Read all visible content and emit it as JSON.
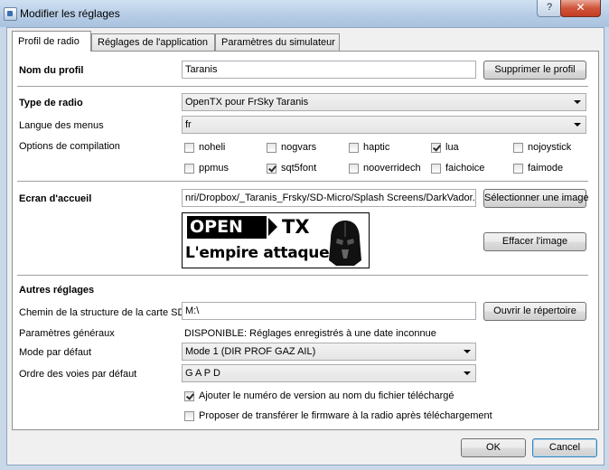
{
  "window": {
    "title": "Modifier les réglages",
    "help_label": "?",
    "close_label": "✕"
  },
  "tabs": [
    {
      "label": "Profil de radio",
      "active": true
    },
    {
      "label": "Réglages de l'application",
      "active": false
    },
    {
      "label": "Paramètres du simulateur",
      "active": false
    }
  ],
  "profile": {
    "name_label": "Nom du profil",
    "name_value": "Taranis",
    "delete_button": "Supprimer le profil"
  },
  "radio": {
    "type_label": "Type de radio",
    "type_value": "OpenTX pour FrSky Taranis",
    "language_label": "Langue des menus",
    "language_value": "fr",
    "compile_label": "Options de compilation",
    "options": [
      {
        "label": "noheli",
        "checked": false
      },
      {
        "label": "nogvars",
        "checked": false
      },
      {
        "label": "haptic",
        "checked": false
      },
      {
        "label": "lua",
        "checked": true
      },
      {
        "label": "nojoystick",
        "checked": false
      },
      {
        "label": "ppmus",
        "checked": false
      },
      {
        "label": "sqt5font",
        "checked": true
      },
      {
        "label": "nooverridech",
        "checked": false
      },
      {
        "label": "faichoice",
        "checked": false
      },
      {
        "label": "faimode",
        "checked": false
      }
    ]
  },
  "splash": {
    "label": "Ecran d'accueil",
    "path_value": "nri/Dropbox/_Taranis_Frsky/SD-Micro/Splash Screens/DarkVador.bmp",
    "select_button": "Sélectionner une image",
    "clear_button": "Effacer l'image",
    "image_line1_a": "OPEN",
    "image_line1_b": "TX",
    "image_line2": "L'empire attaque"
  },
  "other": {
    "heading": "Autres réglages",
    "sd_label": "Chemin de la structure de la carte SD",
    "sd_value": "M:\\",
    "open_dir_button": "Ouvrir le répertoire",
    "general_label": "Paramètres généraux",
    "general_value": "DISPONIBLE: Réglages enregistrés à une date inconnue",
    "mode_label": "Mode par défaut",
    "mode_value": "Mode 1 (DIR PROF GAZ AIL)",
    "order_label": "Ordre des voies par défaut",
    "order_value": "G A P D",
    "append_version_label": "Ajouter le numéro de version au nom du fichier téléchargé",
    "append_version_checked": true,
    "offer_transfer_label": "Proposer de transférer le firmware à la radio après téléchargement",
    "offer_transfer_checked": false
  },
  "footer": {
    "ok_button": "OK",
    "cancel_button": "Cancel"
  }
}
